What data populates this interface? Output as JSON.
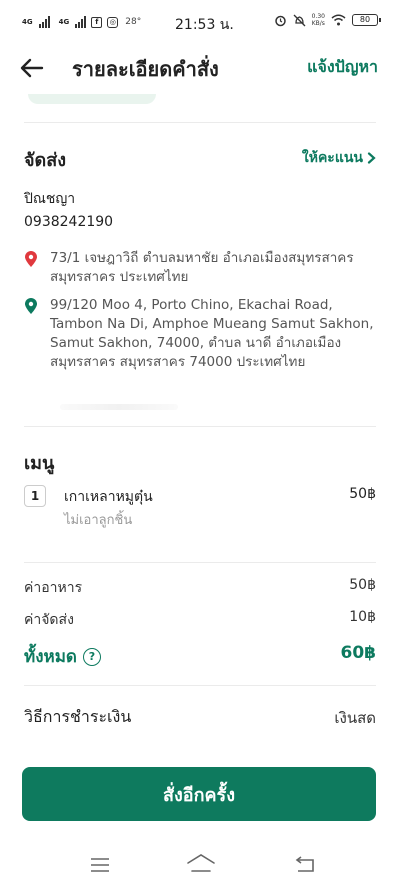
{
  "status_bar": {
    "net_tag_1": "4G",
    "net_tag_2": "4G",
    "temperature": "28°",
    "time": "21:53 น.",
    "speed_value": "0.30",
    "speed_unit": "KB/s",
    "battery": "80"
  },
  "header": {
    "title": "รายละเอียดคำสั่ง",
    "report_label": "แจ้งปัญหา"
  },
  "delivery": {
    "title": "จัดส่ง",
    "rate_label": "ให้คะแนน",
    "rider_name": "ปิณชญา",
    "rider_phone": "0938242190",
    "pickup_address": "73/1 เจษฎาวิถี ตำบลมหาชัย อำเภอเมืองสมุทรสาคร สมุทรสาคร ประเทศไทย",
    "dropoff_address": "99/120 Moo 4, Porto Chino, Ekachai Road, Tambon Na Di, Amphoe Mueang Samut Sakhon, Samut Sakhon, 74000, ตำบล นาดี อำเภอเมืองสมุทรสาคร สมุทรสาคร 74000 ประเทศไทย"
  },
  "menu": {
    "title": "เมนู",
    "items": [
      {
        "qty": "1",
        "name": "เกาเหลาหมูตุ๋น",
        "option": "ไม่เอาลูกชิ้น",
        "price": "50฿"
      }
    ]
  },
  "summary": {
    "food_label": "ค่าอาหาร",
    "food_value": "50฿",
    "delivery_label": "ค่าจัดส่ง",
    "delivery_value": "10฿",
    "total_label": "ทั้งหมด",
    "total_value": "60฿"
  },
  "payment": {
    "label": "วิธีการชำระเงิน",
    "value": "เงินสด"
  },
  "actions": {
    "reorder_label": "สั่งอีกครั้ง"
  },
  "colors": {
    "brand": "#0e7a5e",
    "pickup_pin": "#e0393e",
    "dropoff_pin": "#0d7a5f"
  }
}
